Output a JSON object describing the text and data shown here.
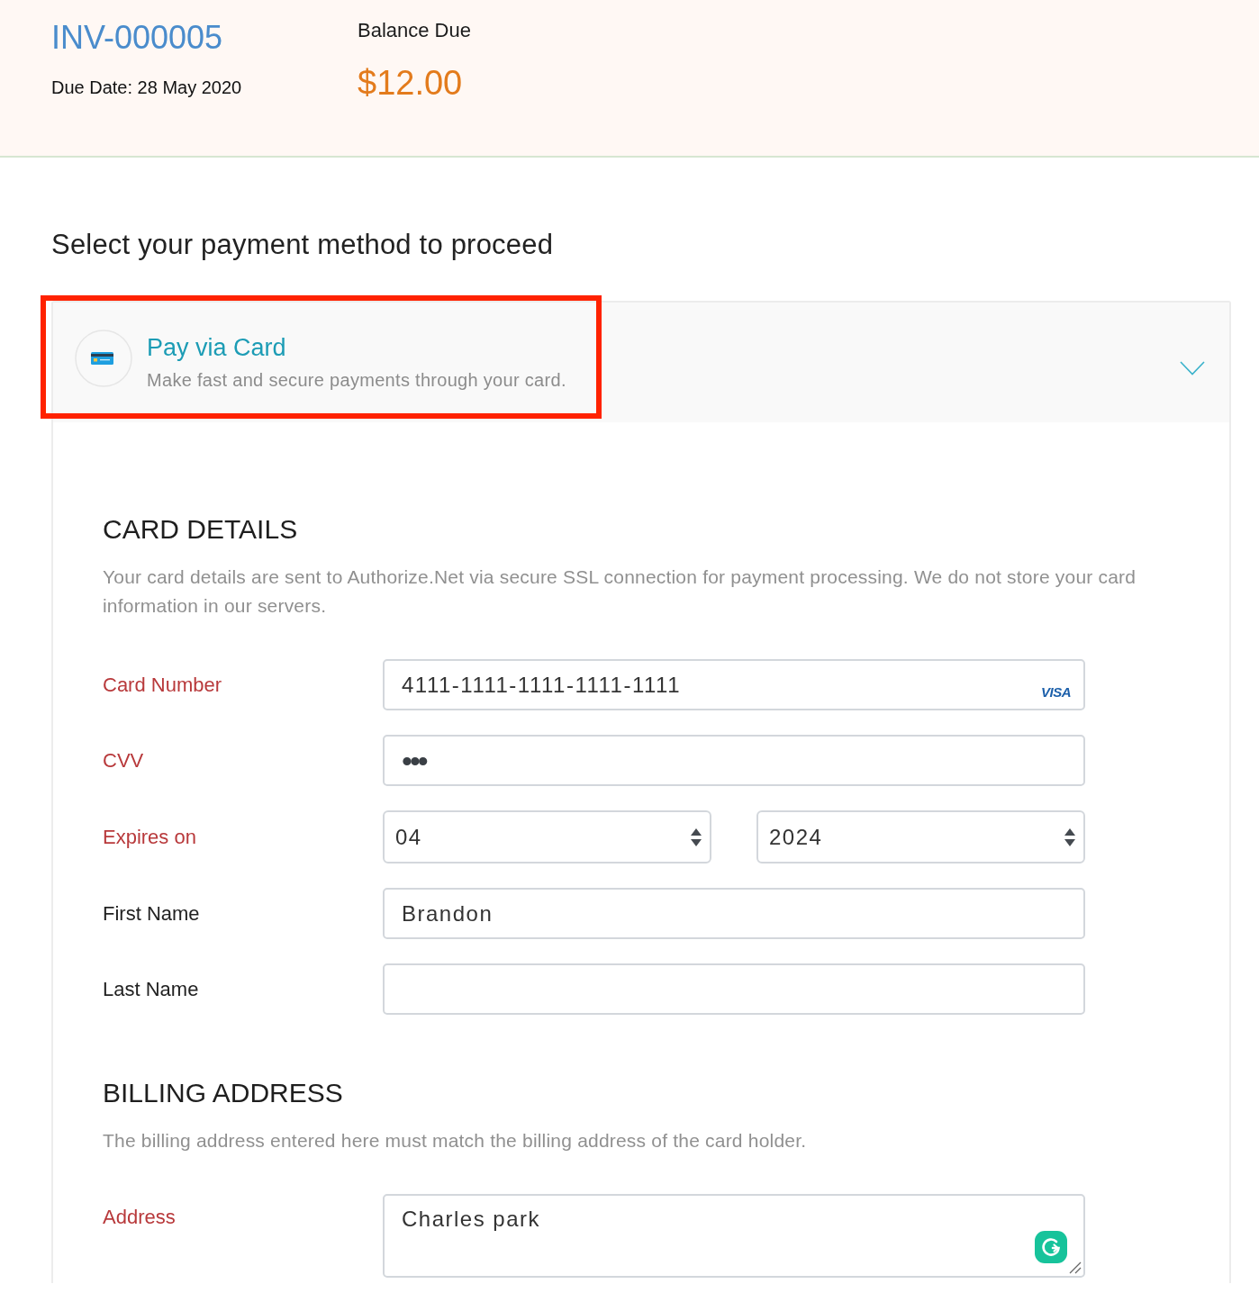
{
  "invoice": {
    "number": "INV-000005",
    "due_date": "Due Date: 28 May 2020",
    "balance_label": "Balance Due",
    "balance": "$12.00"
  },
  "heading": "Select your payment method to proceed",
  "payment_methods": [
    {
      "title": "Pay via Card",
      "subtitle": "Make fast and secure payments through your card.",
      "expanded": true,
      "highlighted": true,
      "sections": [
        {
          "title": "CARD DETAILS",
          "note": "Your card details are sent to Authorize.Net via secure SSL connection for payment processing. We do not store your card information in our servers.",
          "fields": [
            {
              "kind": "text",
              "label": "Card Number",
              "required": true,
              "value": "4111-1111-1111-1111-1111",
              "brand": "VISA"
            },
            {
              "kind": "password",
              "label": "CVV",
              "required": true,
              "value": "•••"
            },
            {
              "kind": "select_pair",
              "label": "Expires on",
              "required": true,
              "selects": [
                "04",
                "2024"
              ]
            },
            {
              "kind": "text",
              "label": "First Name",
              "required": false,
              "value": "Brandon"
            },
            {
              "kind": "text",
              "label": "Last Name",
              "required": false
            }
          ]
        },
        {
          "title": "BILLING ADDRESS",
          "note": "The billing address entered here must match the billing address of the card holder.",
          "fields": [
            {
              "kind": "textarea",
              "label": "Address",
              "required": true,
              "value": "Charles park"
            }
          ]
        }
      ]
    }
  ]
}
